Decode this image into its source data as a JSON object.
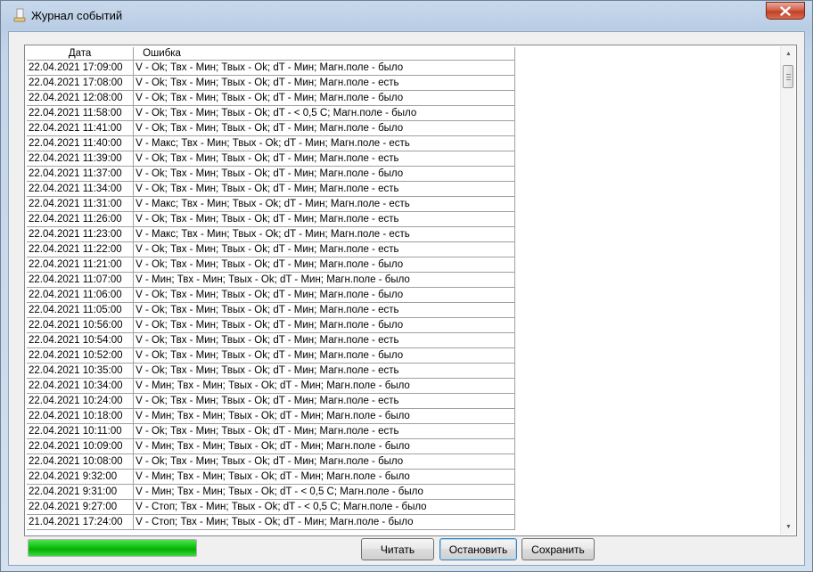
{
  "window": {
    "title": "Журнал событий"
  },
  "log": {
    "columns": {
      "date": "Дата",
      "error": "Ошибка"
    },
    "rows": [
      {
        "date": "22.04.2021 17:09:00",
        "error": "V - Ok; Твх - Мин; Твых - Ok; dT - Мин; Магн.поле - было"
      },
      {
        "date": "22.04.2021 17:08:00",
        "error": "V - Ok; Твх - Мин; Твых - Ok; dT - Мин; Магн.поле - есть"
      },
      {
        "date": "22.04.2021 12:08:00",
        "error": "V - Ok; Твх - Мин; Твых - Ok; dT - Мин; Магн.поле - было"
      },
      {
        "date": "22.04.2021 11:58:00",
        "error": "V - Ok; Твх - Мин; Твых - Ok; dT - < 0,5 С; Магн.поле - было"
      },
      {
        "date": "22.04.2021 11:41:00",
        "error": "V - Ok; Твх - Мин; Твых - Ok; dT - Мин; Магн.поле - было"
      },
      {
        "date": "22.04.2021 11:40:00",
        "error": "V - Макс; Твх - Мин; Твых - Ok; dT - Мин; Магн.поле - есть"
      },
      {
        "date": "22.04.2021 11:39:00",
        "error": "V - Ok; Твх - Мин; Твых - Ok; dT - Мин; Магн.поле - есть"
      },
      {
        "date": "22.04.2021 11:37:00",
        "error": "V - Ok; Твх - Мин; Твых - Ok; dT - Мин; Магн.поле - было"
      },
      {
        "date": "22.04.2021 11:34:00",
        "error": "V - Ok; Твх - Мин; Твых - Ok; dT - Мин; Магн.поле - есть"
      },
      {
        "date": "22.04.2021 11:31:00",
        "error": "V - Макс; Твх - Мин; Твых - Ok; dT - Мин; Магн.поле - есть"
      },
      {
        "date": "22.04.2021 11:26:00",
        "error": "V - Ok; Твх - Мин; Твых - Ok; dT - Мин; Магн.поле - есть"
      },
      {
        "date": "22.04.2021 11:23:00",
        "error": "V - Макс; Твх - Мин; Твых - Ok; dT - Мин; Магн.поле - есть"
      },
      {
        "date": "22.04.2021 11:22:00",
        "error": "V - Ok; Твх - Мин; Твых - Ok; dT - Мин; Магн.поле - есть"
      },
      {
        "date": "22.04.2021 11:21:00",
        "error": "V - Ok; Твх - Мин; Твых - Ok; dT - Мин; Магн.поле - было"
      },
      {
        "date": "22.04.2021 11:07:00",
        "error": "V - Мин; Твх - Мин; Твых - Ok; dT - Мин; Магн.поле - было"
      },
      {
        "date": "22.04.2021 11:06:00",
        "error": "V - Ok; Твх - Мин; Твых - Ok; dT - Мин; Магн.поле - было"
      },
      {
        "date": "22.04.2021 11:05:00",
        "error": "V - Ok; Твх - Мин; Твых - Ok; dT - Мин; Магн.поле - есть"
      },
      {
        "date": "22.04.2021 10:56:00",
        "error": "V - Ok; Твх - Мин; Твых - Ok; dT - Мин; Магн.поле - было"
      },
      {
        "date": "22.04.2021 10:54:00",
        "error": "V - Ok; Твх - Мин; Твых - Ok; dT - Мин; Магн.поле - есть"
      },
      {
        "date": "22.04.2021 10:52:00",
        "error": "V - Ok; Твх - Мин; Твых - Ok; dT - Мин; Магн.поле - было"
      },
      {
        "date": "22.04.2021 10:35:00",
        "error": "V - Ok; Твх - Мин; Твых - Ok; dT - Мин; Магн.поле - есть"
      },
      {
        "date": "22.04.2021 10:34:00",
        "error": "V - Мин; Твх - Мин; Твых - Ok; dT - Мин; Магн.поле - было"
      },
      {
        "date": "22.04.2021 10:24:00",
        "error": "V - Ok; Твх - Мин; Твых - Ok; dT - Мин; Магн.поле - есть"
      },
      {
        "date": "22.04.2021 10:18:00",
        "error": "V - Мин; Твх - Мин; Твых - Ok; dT - Мин; Магн.поле - было"
      },
      {
        "date": "22.04.2021 10:11:00",
        "error": "V - Ok; Твх - Мин; Твых - Ok; dT - Мин; Магн.поле - есть"
      },
      {
        "date": "22.04.2021 10:09:00",
        "error": "V - Мин; Твх - Мин; Твых - Ok; dT - Мин; Магн.поле - было"
      },
      {
        "date": "22.04.2021 10:08:00",
        "error": "V - Ok; Твх - Мин; Твых - Ok; dT - Мин; Магн.поле - было"
      },
      {
        "date": "22.04.2021 9:32:00",
        "error": "V - Мин; Твх - Мин; Твых - Ok; dT - Мин; Магн.поле - было"
      },
      {
        "date": "22.04.2021 9:31:00",
        "error": "V - Мин; Твх - Мин; Твых - Ok; dT - < 0,5 С; Магн.поле - было"
      },
      {
        "date": "22.04.2021 9:27:00",
        "error": "V - Стоп; Твх - Мин; Твых - Ok; dT - < 0,5 С; Магн.поле - было"
      },
      {
        "date": "21.04.2021 17:24:00",
        "error": "V - Стоп; Твх - Мин; Твых - Ok; dT - Мин; Магн.поле - было"
      }
    ]
  },
  "progress": {
    "value": 1.0,
    "color": "#16c116"
  },
  "buttons": {
    "read": "Читать",
    "stop": "Остановить",
    "save": "Сохранить"
  },
  "icons": {
    "title": "app-icon",
    "close": "close-icon",
    "scroll_up": "arrow-up-icon",
    "scroll_down": "arrow-down-icon"
  }
}
